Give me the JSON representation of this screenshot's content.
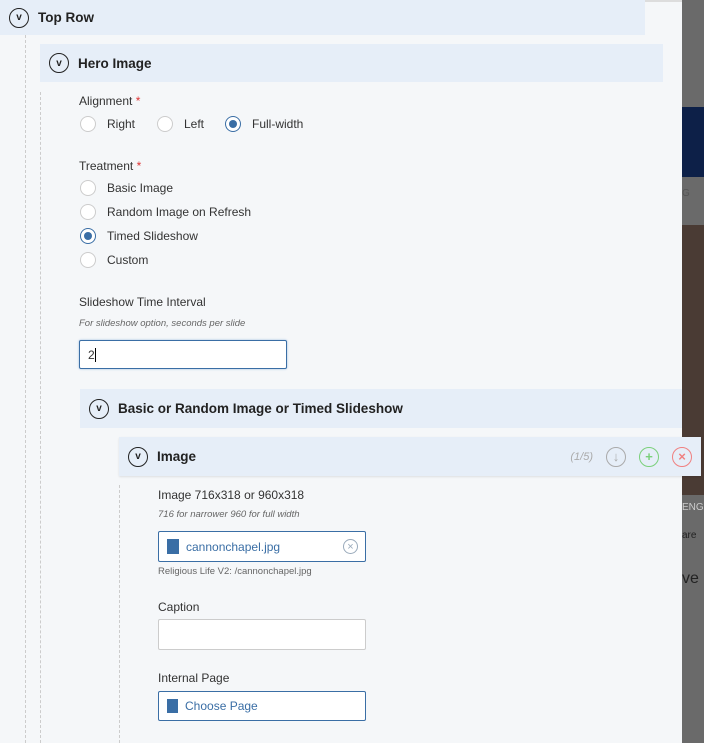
{
  "sections": {
    "top_row": "Top Row",
    "hero_image": "Hero Image",
    "basic_group": "Basic or Random Image or Timed Slideshow",
    "image": "Image"
  },
  "alignment": {
    "label": "Alignment",
    "required": "*",
    "options": [
      "Right",
      "Left",
      "Full-width"
    ],
    "selected": "Full-width"
  },
  "treatment": {
    "label": "Treatment",
    "required": "*",
    "options": [
      "Basic Image",
      "Random Image on Refresh",
      "Timed Slideshow",
      "Custom"
    ],
    "selected": "Timed Slideshow"
  },
  "interval": {
    "label": "Slideshow Time Interval",
    "help": "For slideshow option, seconds per slide",
    "value": "2"
  },
  "image_item": {
    "counter": "(1/5)",
    "label": "Image 716x318 or 960x318",
    "help": "716 for narrower 960 for full width",
    "file": "cannonchapel.jpg",
    "path": "Religious Life V2: /cannonchapel.jpg"
  },
  "caption": {
    "label": "Caption",
    "value": ""
  },
  "internal_page": {
    "label": "Internal Page",
    "button": "Choose Page"
  },
  "background_text": [
    "G",
    "ENG",
    "are",
    "ve"
  ],
  "colors": {
    "accent": "#3a6ea5",
    "required": "#dd3333",
    "add": "#7bd07b",
    "remove": "#f08080"
  }
}
